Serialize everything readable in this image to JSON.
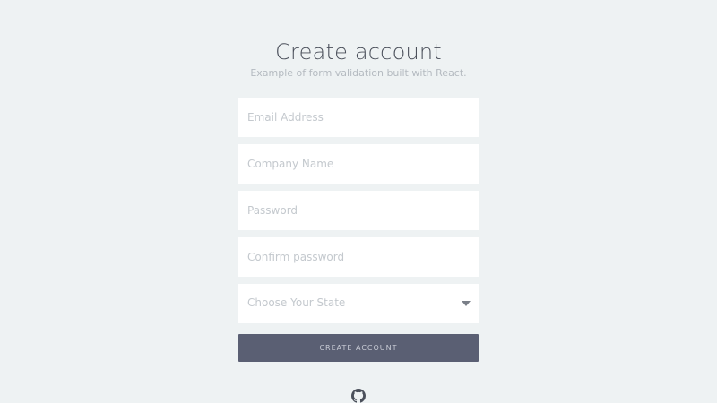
{
  "header": {
    "title": "Create account",
    "subtitle": "Example of form validation built with React."
  },
  "form": {
    "email": {
      "placeholder": "Email Address",
      "value": ""
    },
    "company": {
      "placeholder": "Company Name",
      "value": ""
    },
    "password": {
      "placeholder": "Password",
      "value": ""
    },
    "confirm_password": {
      "placeholder": "Confirm password",
      "value": ""
    },
    "state_select": {
      "selected_label": "Choose Your State"
    },
    "submit_label": "CREATE ACCOUNT"
  },
  "footer": {
    "icon": "github-icon"
  },
  "colors": {
    "background": "#eef2f3",
    "button": "#5a5f73",
    "field": "#ffffff"
  }
}
